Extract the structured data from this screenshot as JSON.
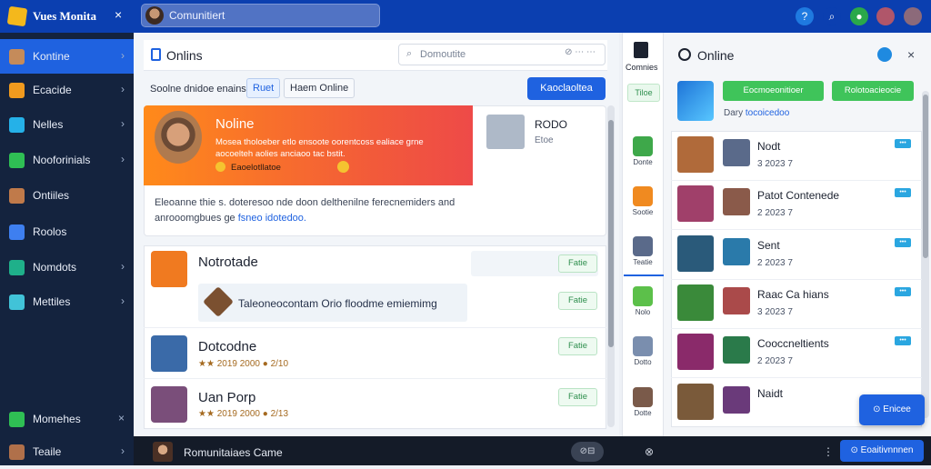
{
  "app": {
    "name": "Vues Monita",
    "close": "×"
  },
  "topbar": {
    "search_text": "Comunitiert",
    "icons": [
      {
        "name": "help-icon",
        "color": "#1f7ae0",
        "glyph": "?"
      },
      {
        "name": "search-icon",
        "color": "#0b3fb0",
        "glyph": "⌕"
      },
      {
        "name": "notification-icon",
        "color": "#2aa84a",
        "glyph": "●"
      },
      {
        "name": "user-avatar",
        "color": "#b0566a",
        "glyph": ""
      },
      {
        "name": "profile-avatar",
        "color": "#8c6a7a",
        "glyph": ""
      }
    ]
  },
  "sidebar": {
    "items": [
      {
        "label": "Kontine",
        "icon": "avatar-icon",
        "color": "#c58b5a",
        "chevron": "›"
      },
      {
        "label": "Ecacide",
        "icon": "puzzle-icon",
        "color": "#f09a1e",
        "chevron": "›"
      },
      {
        "label": "Nelles",
        "icon": "chat-icon",
        "color": "#25b1e8",
        "chevron": "›"
      },
      {
        "label": "Nooforinials",
        "icon": "grid-icon",
        "color": "#2fbf54",
        "chevron": "›"
      },
      {
        "label": "Ontiiles",
        "icon": "character-icon",
        "color": "#c07a4a",
        "chevron": ""
      },
      {
        "label": "Roolos",
        "icon": "chart-icon",
        "color": "#3e7ff0",
        "chevron": ""
      },
      {
        "label": "Nomdots",
        "icon": "image-icon",
        "color": "#1fb08a",
        "chevron": "›"
      },
      {
        "label": "Mettiles",
        "icon": "globe-icon",
        "color": "#41c3d8",
        "chevron": "›"
      },
      {
        "label": "Momehes",
        "icon": "message-icon",
        "color": "#2fbf54",
        "chevron": "×"
      },
      {
        "label": "Teaile",
        "icon": "avatar-icon",
        "color": "#b0704a",
        "chevron": "›"
      }
    ]
  },
  "main": {
    "title": "Onlins",
    "search_text": "Domoutite",
    "search_icons": "⊘ ⋯  ⋯",
    "filter_label": "Soolne dnidoe enains",
    "chips": [
      "Ruet",
      "Haem Online"
    ],
    "add_button": "Kaoclaoltea",
    "hero": {
      "title": "Noline",
      "description": "Mosea tholoeber etlo ensoote oorentcoss ealiace grne aocoelteh aolies anciaoo tac bstit.",
      "meta": "Eaoelotllatoe",
      "footer": "Eleoanne thie s. doteresoo nde doon delthenilne ferecnemiders and anrooomgbues ge",
      "footer_link": "fsneo idotedoo.",
      "side_title": "RODO",
      "side_sub": "Etoe"
    },
    "list": [
      {
        "title": "Notrotade",
        "meta": "",
        "button": "Fatie",
        "thumb": "#f07a20"
      },
      {
        "title": "Dotcodne",
        "meta": "★★ 2019  2000  ● 2/10",
        "button": "Fatie",
        "thumb": "#3a6aa8"
      },
      {
        "title": "Uan Porp",
        "meta": "★★ 2019  2000  ● 2/13",
        "button": "Fatie",
        "thumb": "#7a4e7a"
      }
    ],
    "subrow": {
      "text": "Taleoneocontam Orio floodme emiemimg",
      "button": "Fatie"
    }
  },
  "strip": {
    "label": "Comnies",
    "chip": "Tiloe",
    "items": [
      {
        "label": "Donte",
        "color": "#3ea84a"
      },
      {
        "label": "Sootie",
        "color": "#f08a20"
      },
      {
        "label": "Teatie",
        "color": "#5a6a8a"
      },
      {
        "label": "Nolo",
        "color": "#5cc04a"
      },
      {
        "label": "Dotto",
        "color": "#7a8eae"
      },
      {
        "label": "Dotte",
        "color": "#7a5a4a"
      }
    ]
  },
  "right_panel": {
    "title": "Online",
    "btn1": "Eocmoeonitioer",
    "btn2": "Rolotoacieocie",
    "sub": "Dary",
    "sub_link": "tocoicedoo",
    "items": [
      {
        "title": "Nodt",
        "sub": "3  2023  7",
        "c1": "#b06a3a",
        "c2": "#5a6a8a"
      },
      {
        "title": "Patot Contenede",
        "sub": "2  2023  7",
        "c1": "#a0406a",
        "c2": "#8a5a4a"
      },
      {
        "title": "Sent",
        "sub": "2  2023  7",
        "c1": "#2a5a7a",
        "c2": "#2a7aaa"
      },
      {
        "title": "Raac Ca hians",
        "sub": "3  2023  7",
        "c1": "#3a8a3a",
        "c2": "#aa4a4a"
      },
      {
        "title": "Cooccneltients",
        "sub": "2  2023  7",
        "c1": "#8a2a6a",
        "c2": "#2a7a4a"
      },
      {
        "title": "Naidt",
        "sub": "",
        "c1": "#7a5a3a",
        "c2": "#6a3a7a"
      }
    ],
    "tag": "•••",
    "float_button": "Enicee"
  },
  "bottombar": {
    "text": "Romunitaiaes Came",
    "pill": "⊘⊟",
    "close": "⊗",
    "more": "⋮",
    "button": "Eoaitivnnnen"
  }
}
